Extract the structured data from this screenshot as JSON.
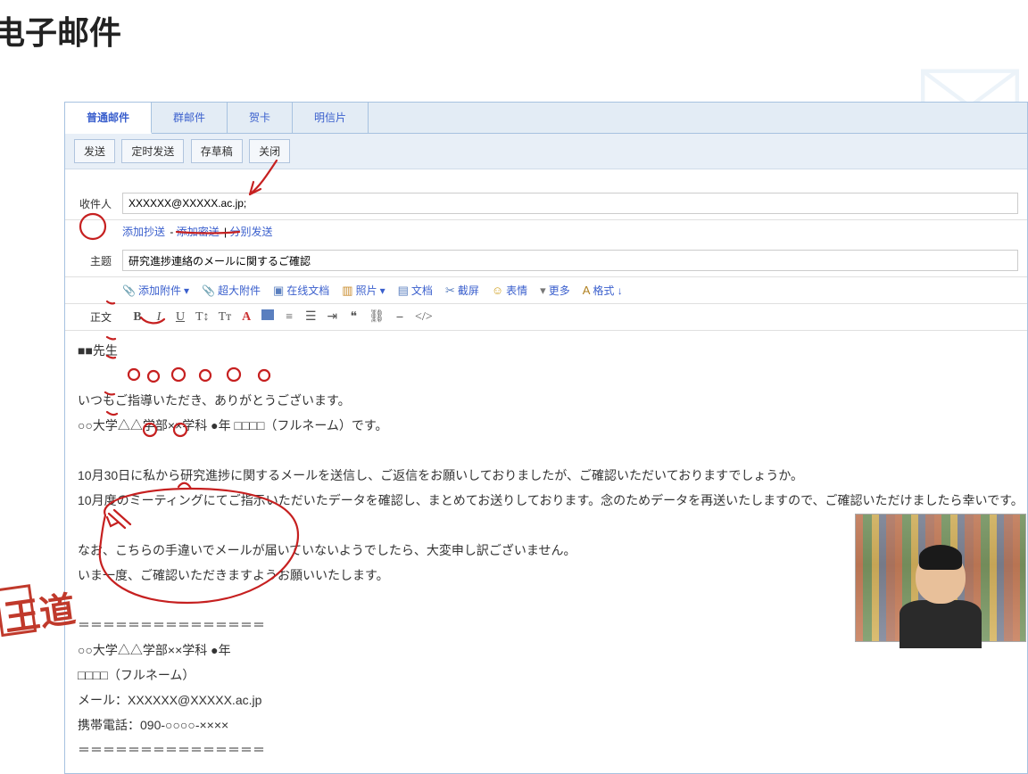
{
  "page_heading": "电子邮件",
  "tabs": {
    "t0": "普通邮件",
    "t1": "群邮件",
    "t2": "贺卡",
    "t3": "明信片"
  },
  "actions": {
    "send": "发送",
    "schedule": "定时发送",
    "draft": "存草稿",
    "close": "关闭"
  },
  "fields": {
    "to_label": "收件人",
    "to_value": "XXXXXX@XXXXX.ac.jp;",
    "subject_label": "主题",
    "subject_value": "研究進捗連絡のメールに関するご確認",
    "body_label": "正文"
  },
  "links": {
    "cc": "添加抄送",
    "bcc": "添加密送",
    "sep1": " - ",
    "sep2": " | ",
    "split": "分别发送"
  },
  "attach": {
    "a0": "添加附件",
    "a1": "超大附件",
    "a2": "在线文档",
    "a3": "照片",
    "a4": "文档",
    "a5": "截屏",
    "a6": "表情",
    "a7": "更多",
    "a8": "格式 ↓"
  },
  "body": {
    "l0": "■■先生",
    "l1": "",
    "l2": "いつもご指導いただき、ありがとうございます。",
    "l3": "○○大学△△学部××学科 ●年 □□□□（フルネーム）です。",
    "l4": "",
    "l5": "10月30日に私から研究進捗に関するメールを送信し、ご返信をお願いしておりましたが、ご確認いただいておりますでしょうか。",
    "l6": "10月度のミーティングにてご指示いただいたデータを確認し、まとめてお送りしております。念のためデータを再送いたしますので、ご確認いただけましたら幸いです。",
    "l7": "",
    "l8": "なお、こちらの手違いでメールが届いていないようでしたら、大変申し訳ございません。",
    "l9": "いま一度、ご確認いただきますようお願いいたします。",
    "l10": "",
    "l11": "＝＝＝＝＝＝＝＝＝＝＝＝＝＝＝",
    "l12": "○○大学△△学部××学科 ●年",
    "l13": "□□□□（フルネーム）",
    "l14": "メール：XXXXXX@XXXXX.ac.jp",
    "l15": "携帯電話：090-○○○○-××××",
    "l16": "＝＝＝＝＝＝＝＝＝＝＝＝＝＝＝"
  },
  "stamp": "王道"
}
